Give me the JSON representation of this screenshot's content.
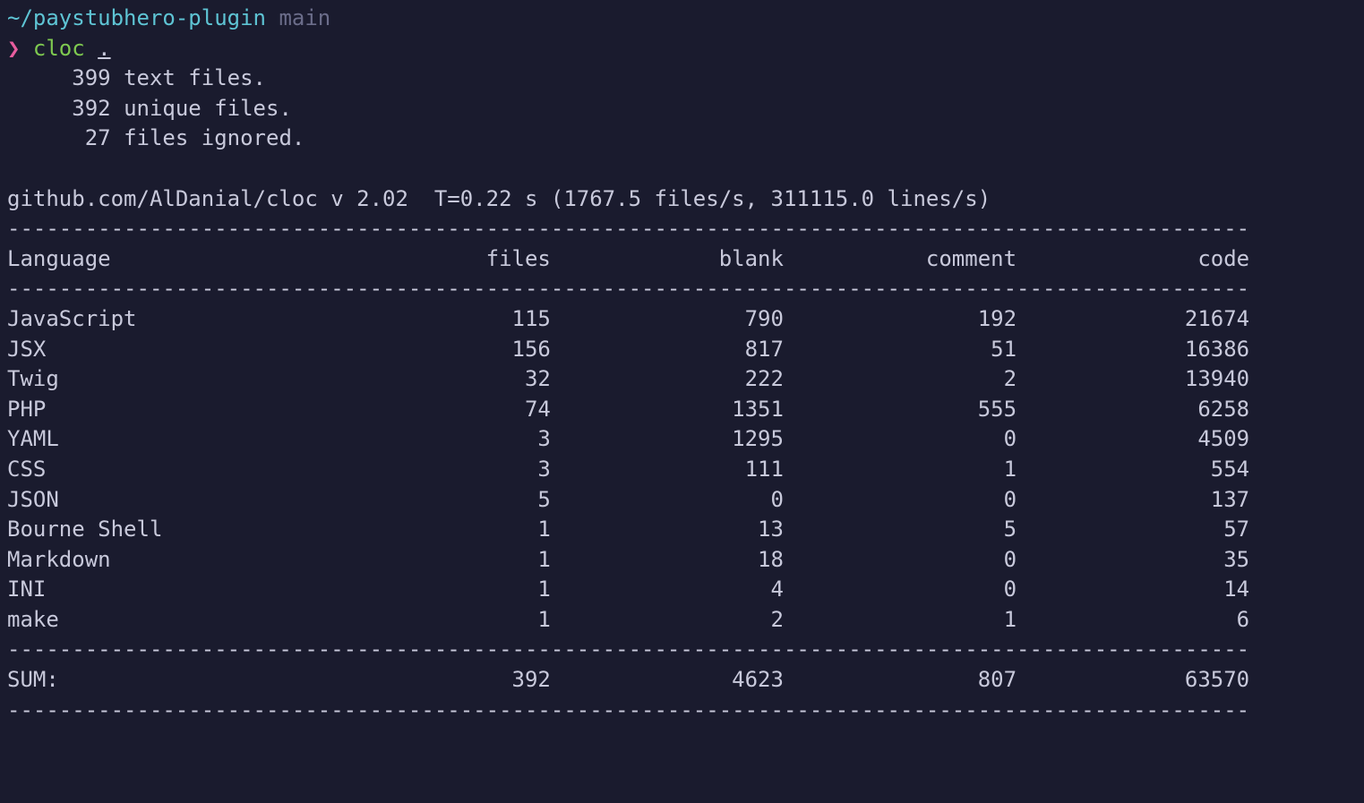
{
  "prompt": {
    "path": "~/paystubhero-plugin",
    "branch": "main",
    "symbol": "❯",
    "command": "cloc",
    "args": "."
  },
  "summary": {
    "text_files": "399",
    "text_files_label": "text files.",
    "unique_files": "392",
    "unique_files_label": "unique files.",
    "ignored": "27",
    "ignored_label": "files ignored."
  },
  "meta": "github.com/AlDanial/cloc v 2.02  T=0.22 s (1767.5 files/s, 311115.0 lines/s)",
  "headers": {
    "language": "Language",
    "files": "files",
    "blank": "blank",
    "comment": "comment",
    "code": "code"
  },
  "chart_data": {
    "type": "table",
    "columns": [
      "Language",
      "files",
      "blank",
      "comment",
      "code"
    ],
    "rows": [
      {
        "language": "JavaScript",
        "files": "115",
        "blank": "790",
        "comment": "192",
        "code": "21674"
      },
      {
        "language": "JSX",
        "files": "156",
        "blank": "817",
        "comment": "51",
        "code": "16386"
      },
      {
        "language": "Twig",
        "files": "32",
        "blank": "222",
        "comment": "2",
        "code": "13940"
      },
      {
        "language": "PHP",
        "files": "74",
        "blank": "1351",
        "comment": "555",
        "code": "6258"
      },
      {
        "language": "YAML",
        "files": "3",
        "blank": "1295",
        "comment": "0",
        "code": "4509"
      },
      {
        "language": "CSS",
        "files": "3",
        "blank": "111",
        "comment": "1",
        "code": "554"
      },
      {
        "language": "JSON",
        "files": "5",
        "blank": "0",
        "comment": "0",
        "code": "137"
      },
      {
        "language": "Bourne Shell",
        "files": "1",
        "blank": "13",
        "comment": "5",
        "code": "57"
      },
      {
        "language": "Markdown",
        "files": "1",
        "blank": "18",
        "comment": "0",
        "code": "35"
      },
      {
        "language": "INI",
        "files": "1",
        "blank": "4",
        "comment": "0",
        "code": "14"
      },
      {
        "language": "make",
        "files": "1",
        "blank": "2",
        "comment": "1",
        "code": "6"
      }
    ],
    "sum": {
      "label": "SUM:",
      "files": "392",
      "blank": "4623",
      "comment": "807",
      "code": "63570"
    }
  }
}
